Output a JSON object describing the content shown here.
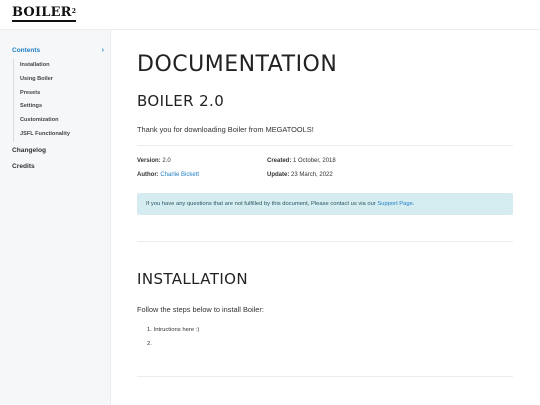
{
  "brand": {
    "name": "BOILER",
    "superscript": "2"
  },
  "sidebar": {
    "contents_label": "Contents",
    "contents_chevron": "chevron-right-icon",
    "sub_items": [
      {
        "label": "Installation"
      },
      {
        "label": "Using Boiler"
      },
      {
        "label": "Presets"
      },
      {
        "label": "Settings"
      },
      {
        "label": "Customization"
      },
      {
        "label": "JSFL Functionality"
      }
    ],
    "changelog_label": "Changelog",
    "credits_label": "Credits"
  },
  "doc": {
    "title": "DOCUMENTATION",
    "subtitle": "BOILER 2.0",
    "thanks": "Thank you for downloading Boiler from MEGATOOLS!",
    "version_label": "Version:",
    "version_value": "2.0",
    "author_label": "Author:",
    "author_value": "Charlie Bickett",
    "created_label": "Created:",
    "created_value": "1 October, 2018",
    "update_label": "Update:",
    "update_value": "23 March, 2022",
    "info_text": "If you have any questions that are not fulfilled by this document, Please contact us via our",
    "info_link": "Support Page.",
    "info_color": "#d5ecf0",
    "link_color": "#1f7fc4"
  },
  "installation": {
    "title": "INSTALLATION",
    "intro": "Follow the steps below to install Boiler:",
    "steps": [
      {
        "num": "1.",
        "text": "Intructions here :)"
      },
      {
        "num": "2.",
        "text": ""
      }
    ]
  }
}
